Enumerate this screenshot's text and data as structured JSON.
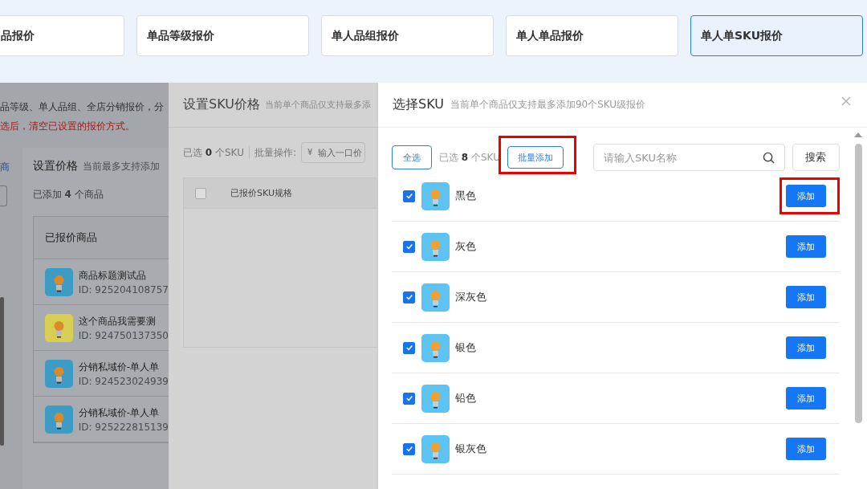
{
  "tabs": [
    {
      "label": "品报价",
      "selected": false
    },
    {
      "label": "单品等级报价",
      "selected": false
    },
    {
      "label": "单人品组报价",
      "selected": false
    },
    {
      "label": "单人单品报价",
      "selected": false
    },
    {
      "label": "单人单SKU报价",
      "selected": true
    }
  ],
  "background_page": {
    "notice": "品等级、单人品组、全店分销报价，分",
    "warning": "选后，清空已设置的报价方式。",
    "side_link": "商",
    "price_panel": {
      "title": "设置价格",
      "hint": "当前最多支持添加",
      "count": "已添加 **4** 个商品",
      "column": "已报价商品",
      "products": [
        {
          "name": "商品标题测试品",
          "id": "ID: 925204108757",
          "color": "#3d9cc6"
        },
        {
          "name": "这个商品我需要测",
          "id": "ID: 924750137350",
          "color": "#d8cf52"
        },
        {
          "name": "分销私域价-单人单",
          "id": "ID: 924523024939",
          "color": "#3d9cc6"
        },
        {
          "name": "分销私域价-单人单",
          "id": "ID: 925222815139",
          "color": "#3d9cc6"
        }
      ]
    }
  },
  "sku_price_drawer": {
    "title": "设置SKU价格",
    "hint": "当前单个商品仅支持最多添",
    "selected": "已选 **0** 个SKU",
    "batch_label": "批量操作:",
    "currency": "¥",
    "price_placeholder": "输入一口价",
    "header_checked": false,
    "column": "已报价SKU规格"
  },
  "select_sku_drawer": {
    "title": "选择SKU",
    "hint": "当前单个商品仅支持最多添加90个SKU级报价",
    "select_all": "全选",
    "selected": "已选 **8** 个SKU",
    "batch_add": "批量添加",
    "batch_add_highlighted": true,
    "search_placeholder": "请输入SKU名称",
    "search_button": "搜索",
    "items": [
      {
        "name": "黑色",
        "checked": true,
        "button": "添加",
        "highlighted": true
      },
      {
        "name": "灰色",
        "checked": true,
        "button": "添加",
        "highlighted": false
      },
      {
        "name": "深灰色",
        "checked": true,
        "button": "添加",
        "highlighted": false
      },
      {
        "name": "银色",
        "checked": true,
        "button": "添加",
        "highlighted": false
      },
      {
        "name": "铅色",
        "checked": true,
        "button": "添加",
        "highlighted": false
      },
      {
        "name": "银灰色",
        "checked": true,
        "button": "添加",
        "highlighted": false
      }
    ]
  }
}
